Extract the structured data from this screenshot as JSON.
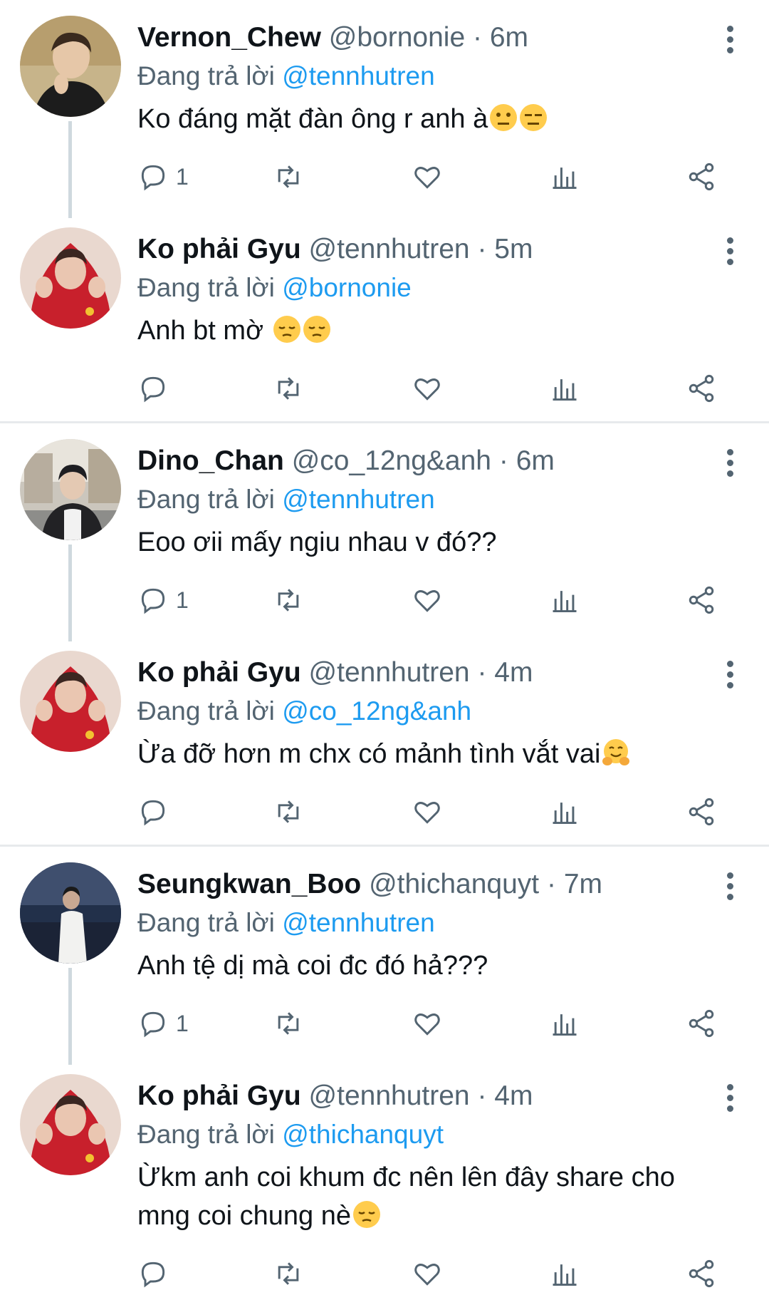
{
  "colors": {
    "link": "#1d9bf0",
    "muted": "#536471",
    "text": "#0f1419",
    "divider": "#e7eaec"
  },
  "tweets": [
    {
      "name": "Vernon_Chew",
      "handle": "@bornonie",
      "dot": "·",
      "time": "6m",
      "reply_prefix": "Đang trả lời",
      "reply_to": "@tennhutren",
      "text": "Ko đáng mặt đàn ông r anh à",
      "emojis": [
        "neutral-face",
        "expressionless-face"
      ],
      "reply_count": "1",
      "avatar": "avatar-beige"
    },
    {
      "name": "Ko phải Gyu",
      "handle": "@tennhutren",
      "dot": "·",
      "time": "5m",
      "reply_prefix": "Đang trả lời",
      "reply_to": "@bornonie",
      "text": "Anh bt mờ ",
      "emojis": [
        "pensive-face",
        "pensive-face"
      ],
      "reply_count": "",
      "avatar": "avatar-red"
    },
    {
      "name": "Dino_Chan",
      "handle": "@co_12ng&anh",
      "dot": "·",
      "time": "6m",
      "reply_prefix": "Đang trả lời",
      "reply_to": "@tennhutren",
      "text": "Eoo ơii mấy ngiu nhau v đó??",
      "emojis": [],
      "reply_count": "1",
      "avatar": "avatar-street"
    },
    {
      "name": "Ko phải Gyu",
      "handle": "@tennhutren",
      "dot": "·",
      "time": "4m",
      "reply_prefix": "Đang trả lời",
      "reply_to": "@co_12ng&anh",
      "text": "Ừa đỡ hơn m chx có mảnh tình vắt vai",
      "emojis": [
        "hugging-face"
      ],
      "reply_count": "",
      "avatar": "avatar-red"
    },
    {
      "name": "Seungkwan_Boo",
      "handle": "@thichanquyt",
      "dot": "·",
      "time": "7m",
      "reply_prefix": "Đang trả lời",
      "reply_to": "@tennhutren",
      "text": "Anh tệ dị mà coi đc đó hả???",
      "emojis": [],
      "reply_count": "1",
      "avatar": "avatar-beach"
    },
    {
      "name": "Ko phải Gyu",
      "handle": "@tennhutren",
      "dot": "·",
      "time": "4m",
      "reply_prefix": "Đang trả lời",
      "reply_to": "@thichanquyt",
      "text_lines": [
        "Ừkm anh coi khum đc nên lên đây share cho",
        "mng coi chung nè"
      ],
      "emojis": [
        "pensive-face"
      ],
      "reply_count": "",
      "avatar": "avatar-red"
    }
  ]
}
